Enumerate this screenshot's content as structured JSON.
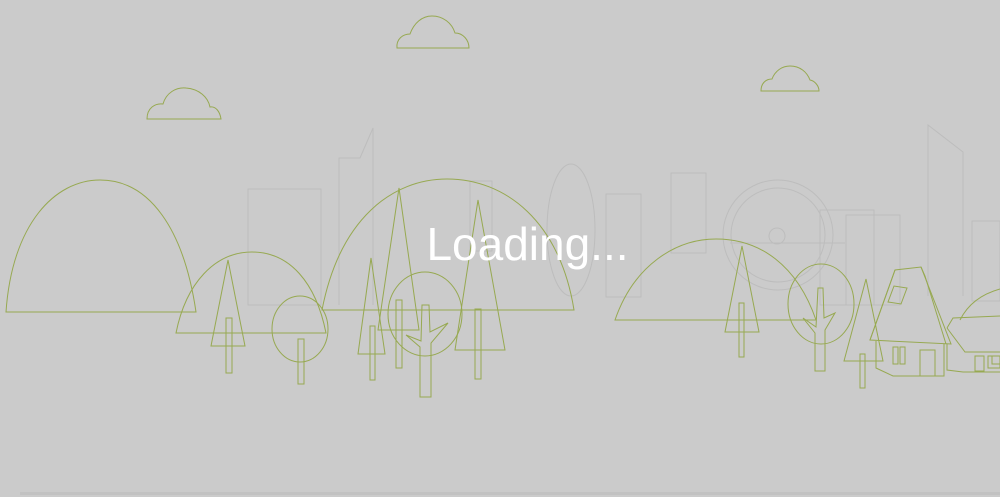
{
  "loading": {
    "text": "Loading..."
  },
  "colors": {
    "background": "#cbcbcb",
    "line_art": "#97a951",
    "faint_buildings": "#bdbdbd",
    "text": "#ffffff"
  },
  "illustration": {
    "subject": "town-landscape-icon"
  }
}
